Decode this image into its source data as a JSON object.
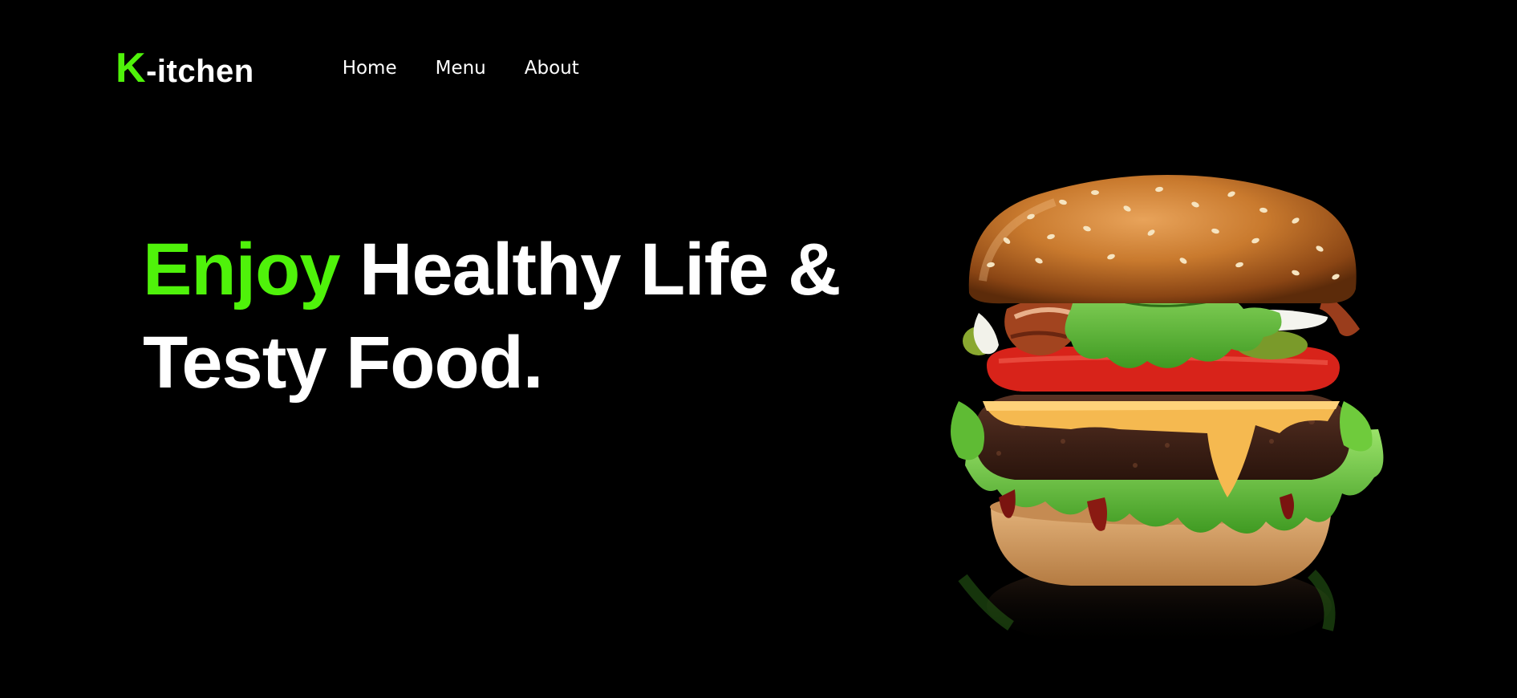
{
  "brand": {
    "accent_letter": "K",
    "rest": "-itchen",
    "accent_color": "#4ff20a"
  },
  "nav": {
    "items": [
      {
        "label": "Home"
      },
      {
        "label": "Menu"
      },
      {
        "label": "About"
      }
    ]
  },
  "hero": {
    "title_accent": "Enjoy",
    "title_line1_rest": " Healthy Life &",
    "title_line2": "Testy Food.",
    "image": "burger"
  },
  "colors": {
    "background": "#000000",
    "text": "#ffffff",
    "accent": "#4ff20a"
  }
}
